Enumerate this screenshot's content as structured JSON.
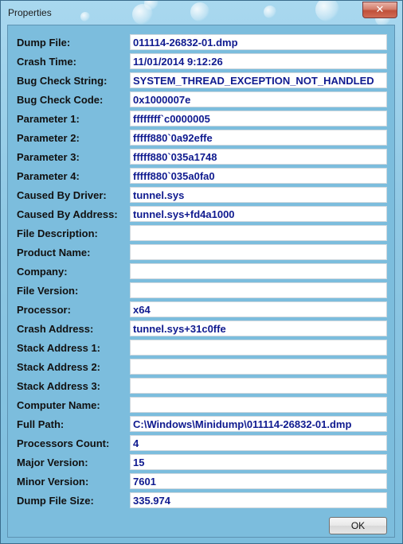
{
  "window": {
    "title": "Properties",
    "close_glyph": "✕"
  },
  "fields": [
    {
      "label": "Dump File:",
      "value": "011114-26832-01.dmp"
    },
    {
      "label": "Crash Time:",
      "value": "11/01/2014 9:12:26"
    },
    {
      "label": "Bug Check String:",
      "value": "SYSTEM_THREAD_EXCEPTION_NOT_HANDLED"
    },
    {
      "label": "Bug Check Code:",
      "value": "0x1000007e"
    },
    {
      "label": "Parameter 1:",
      "value": "ffffffff`c0000005"
    },
    {
      "label": "Parameter 2:",
      "value": "fffff880`0a92effe"
    },
    {
      "label": "Parameter 3:",
      "value": "fffff880`035a1748"
    },
    {
      "label": "Parameter 4:",
      "value": "fffff880`035a0fa0"
    },
    {
      "label": "Caused By Driver:",
      "value": "tunnel.sys"
    },
    {
      "label": "Caused By Address:",
      "value": "tunnel.sys+fd4a1000"
    },
    {
      "label": "File Description:",
      "value": ""
    },
    {
      "label": "Product Name:",
      "value": ""
    },
    {
      "label": "Company:",
      "value": ""
    },
    {
      "label": "File Version:",
      "value": ""
    },
    {
      "label": "Processor:",
      "value": "x64"
    },
    {
      "label": "Crash Address:",
      "value": "tunnel.sys+31c0ffe"
    },
    {
      "label": "Stack Address 1:",
      "value": ""
    },
    {
      "label": "Stack Address 2:",
      "value": ""
    },
    {
      "label": "Stack Address 3:",
      "value": ""
    },
    {
      "label": "Computer Name:",
      "value": ""
    },
    {
      "label": "Full Path:",
      "value": "C:\\Windows\\Minidump\\011114-26832-01.dmp"
    },
    {
      "label": "Processors Count:",
      "value": "4"
    },
    {
      "label": "Major Version:",
      "value": "15"
    },
    {
      "label": "Minor Version:",
      "value": "7601"
    },
    {
      "label": "Dump File Size:",
      "value": "335.974"
    }
  ],
  "ok_label": "OK"
}
